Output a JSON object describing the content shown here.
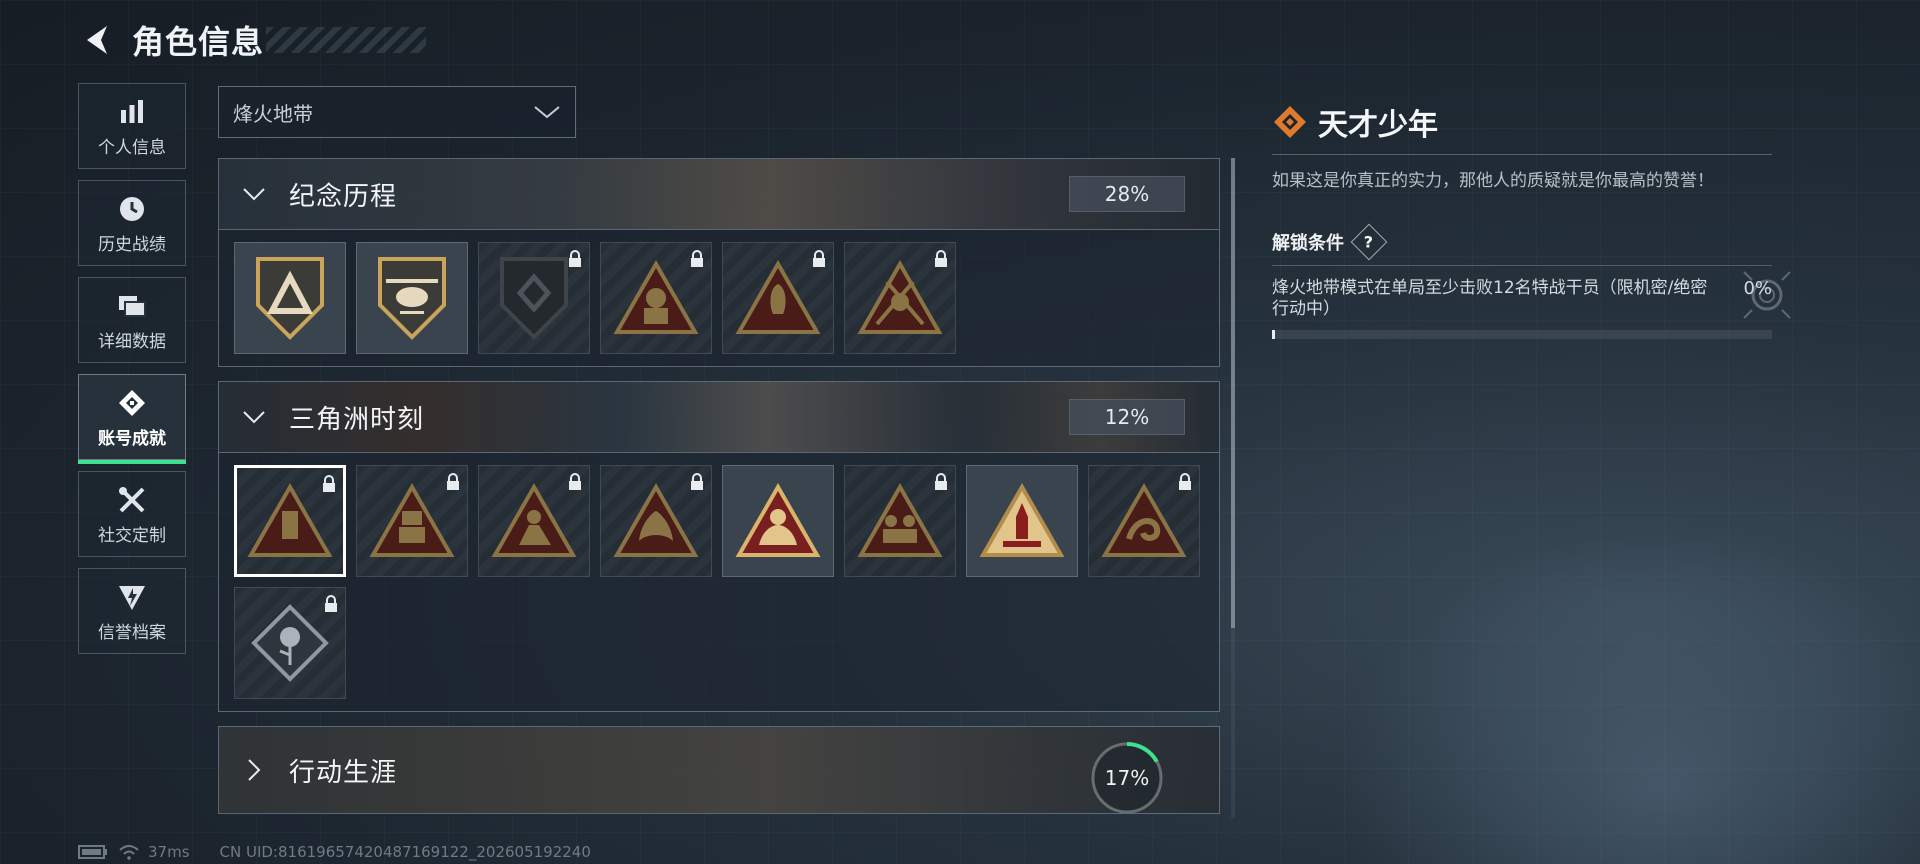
{
  "header": {
    "title": "角色信息"
  },
  "sidebar": {
    "items": [
      {
        "label": "个人信息",
        "icon": "bar-chart-icon",
        "active": false
      },
      {
        "label": "历史战绩",
        "icon": "clock-icon",
        "active": false
      },
      {
        "label": "详细数据",
        "icon": "folder-icon",
        "active": false
      },
      {
        "label": "账号成就",
        "icon": "achievement-icon",
        "active": true
      },
      {
        "label": "社交定制",
        "icon": "tools-icon",
        "active": false
      },
      {
        "label": "信誉档案",
        "icon": "shield-icon",
        "active": false
      }
    ]
  },
  "mode_select": {
    "value": "烽火地带"
  },
  "sections": [
    {
      "title": "纪念历程",
      "percent": "28%",
      "expanded": true,
      "badges": [
        {
          "icon": "triangle-emblem-icon",
          "locked": false,
          "selected": false
        },
        {
          "icon": "helicopter-emblem-icon",
          "locked": false,
          "selected": false
        },
        {
          "icon": "shield-emblem-icon",
          "locked": true,
          "selected": false
        },
        {
          "icon": "soldier-emblem-icon",
          "locked": true,
          "selected": false
        },
        {
          "icon": "warrior-emblem-icon",
          "locked": true,
          "selected": false
        },
        {
          "icon": "crossed-weapons-emblem-icon",
          "locked": true,
          "selected": false
        }
      ]
    },
    {
      "title": "三角洲时刻",
      "percent": "12%",
      "expanded": true,
      "badges": [
        {
          "icon": "drone-emblem-icon",
          "locked": true,
          "selected": true
        },
        {
          "icon": "robot-emblem-icon",
          "locked": true,
          "selected": false
        },
        {
          "icon": "fighter-emblem-icon",
          "locked": true,
          "selected": false
        },
        {
          "icon": "dragon-emblem-icon",
          "locked": true,
          "selected": false
        },
        {
          "icon": "squad-emblem-icon",
          "locked": false,
          "selected": false
        },
        {
          "icon": "team-emblem-icon",
          "locked": true,
          "selected": false
        },
        {
          "icon": "rocket-emblem-icon",
          "locked": false,
          "selected": false
        },
        {
          "icon": "serpent-emblem-icon",
          "locked": true,
          "selected": false
        },
        {
          "icon": "rose-emblem-icon",
          "locked": true,
          "selected": false
        }
      ]
    },
    {
      "title": "行动生涯",
      "percent": "17%",
      "progress": 0.17,
      "expanded": false
    }
  ],
  "detail": {
    "icon": "orange-diamond-icon",
    "title": "天才少年",
    "description": "如果这是你真正的实力，那他人的质疑就是你最高的赞誉！",
    "unlock_label": "解锁条件",
    "help": "?",
    "condition": "烽火地带模式在单局至少击败12名特战干员（限机密/绝密行动中）",
    "condition_percent": "0%",
    "progress": 0.005
  },
  "footer": {
    "ping": "37ms",
    "uid": "CN UID:8161965742048716​9122_202605192240"
  },
  "colors": {
    "accent": "#3fe08f",
    "badge_gold": "#c9a45c",
    "badge_red": "#7a1f1f",
    "title_orange": "#e07a2e"
  }
}
